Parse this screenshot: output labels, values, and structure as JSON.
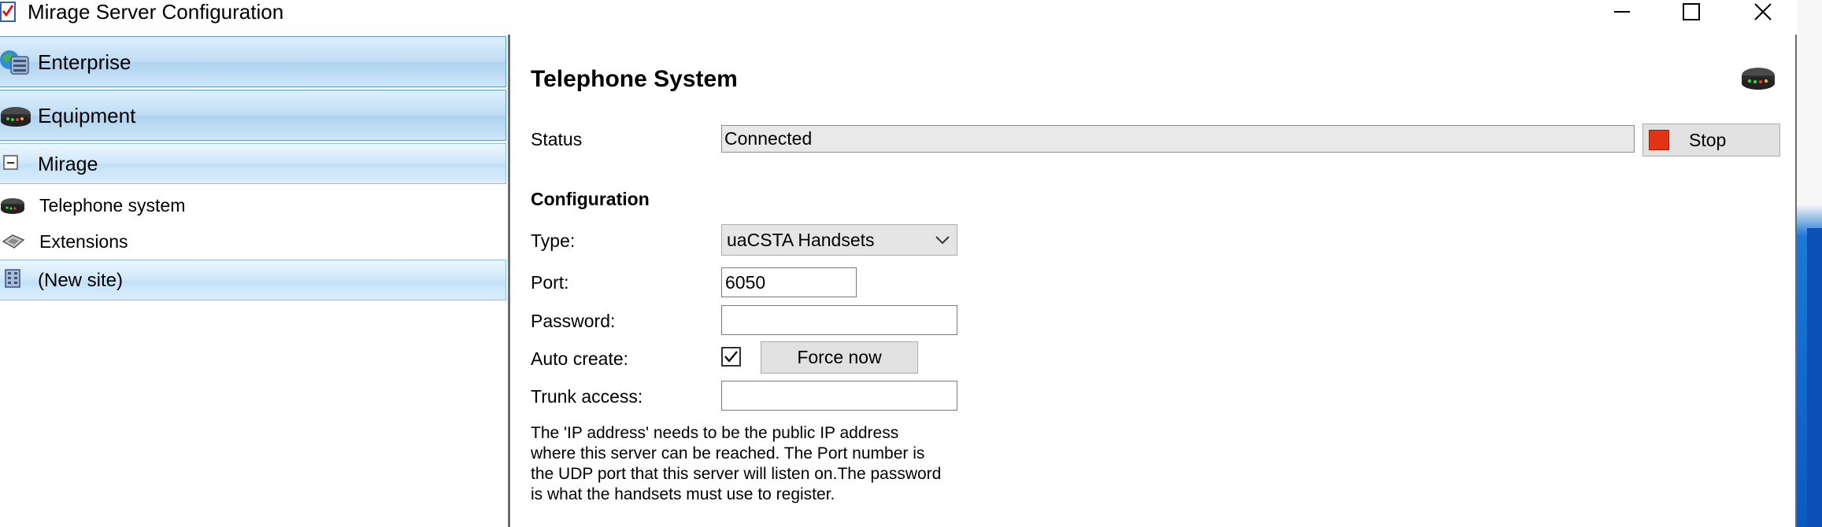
{
  "window": {
    "title": "Mirage Server Configuration",
    "controls": [
      "minimize-icon",
      "maximize-icon",
      "close-icon"
    ]
  },
  "nav": {
    "headers": [
      {
        "label": "Enterprise",
        "icon": "enterprise-globe-icon"
      },
      {
        "label": "Equipment",
        "icon": "equipment-router-icon"
      }
    ],
    "group": {
      "label": "Mirage",
      "icon": "collapse-minus-icon"
    },
    "items": [
      {
        "label": "Telephone system",
        "icon": "telephone-system-icon"
      },
      {
        "label": "Extensions",
        "icon": "extensions-icon"
      }
    ],
    "site": {
      "label": "(New site)",
      "icon": "site-building-icon"
    }
  },
  "panel": {
    "title": "Telephone System",
    "icon": "telephone-system-icon",
    "status": {
      "label": "Status",
      "value": "Connected",
      "button": "Stop",
      "button_color": "#e03414"
    },
    "configuration": {
      "heading": "Configuration",
      "type": {
        "label": "Type:",
        "value": "uaCSTA Handsets"
      },
      "port": {
        "label": "Port:",
        "value": "6050"
      },
      "password": {
        "label": "Password:",
        "value": ""
      },
      "auto_create": {
        "label": "Auto create:",
        "checked": true,
        "button": "Force now"
      },
      "trunk_access": {
        "label": "Trunk access:",
        "value": ""
      }
    },
    "info_text": "The 'IP address' needs to be the public IP address\nwhere this server can be reached. The Port number is\nthe UDP port that this server will listen on.The password\nis what the handsets must use to register."
  }
}
